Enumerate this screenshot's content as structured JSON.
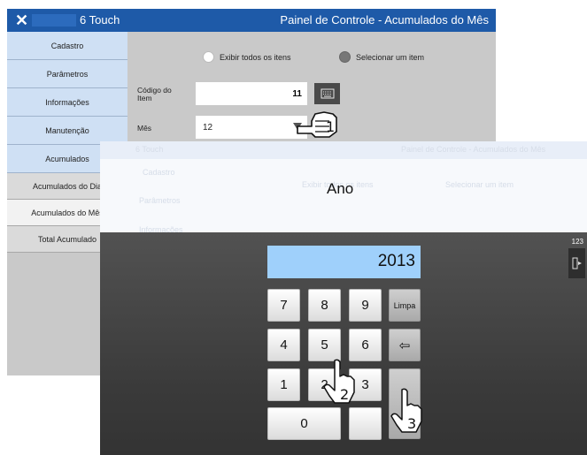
{
  "back_window": {
    "header": {
      "close_icon": "✕",
      "app_title": "6 Touch",
      "panel_title": "Painel de Controle - Acumulados do Mês"
    },
    "sidebar": {
      "items": [
        {
          "label": "Cadastro"
        },
        {
          "label": "Parâmetros"
        },
        {
          "label": "Informações"
        },
        {
          "label": "Manutenção"
        },
        {
          "label": "Acumulados"
        },
        {
          "label": "Acumulados do Dia"
        },
        {
          "label": "Acumulados do Mês"
        },
        {
          "label": "Total Acumulado"
        }
      ]
    },
    "filter": {
      "show_all_label": "Exibir todos os itens",
      "select_one_label": "Selecionar um item",
      "selected": "Selecionar um item"
    },
    "item_code": {
      "label": "Código do Item",
      "value": "11"
    },
    "month": {
      "label": "Mês",
      "value": "12"
    }
  },
  "front_window": {
    "ghost_header": {
      "app_title": "6 Touch",
      "panel_title": "Painel de Controle - Acumulados do Mês"
    },
    "ghost_sidebar": [
      "Cadastro",
      "Parâmetros",
      "Informações"
    ],
    "ghost_filter": {
      "show_all_label": "Exibir todos os itens",
      "select_one_label": "Selecionar um item"
    },
    "dialog_title": "Ano",
    "display_value": "2013",
    "keypad": {
      "digits": [
        "7",
        "8",
        "9",
        "4",
        "5",
        "6",
        "1",
        "2",
        "3",
        "0"
      ],
      "clear_label": "Limpa",
      "backspace_icon": "⇦"
    },
    "side_badge": "123",
    "side_button_icon": "exit-icon"
  },
  "annotations": [
    "1",
    "2",
    "3"
  ],
  "colors": {
    "header_blue": "#1e5aa8",
    "nav_blue": "#cfe0f4",
    "display_blue": "#9fd0fb"
  }
}
